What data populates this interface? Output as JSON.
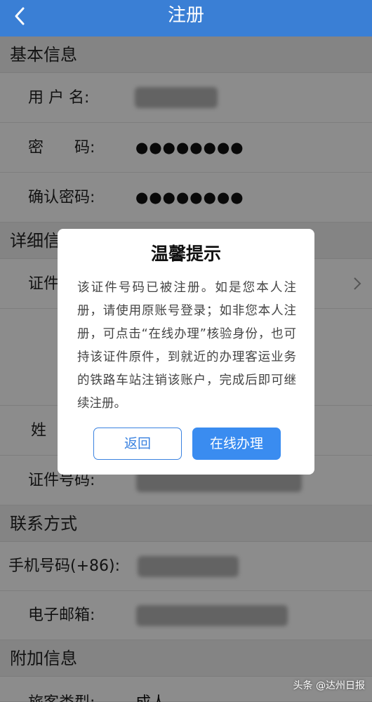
{
  "nav": {
    "title": "注册",
    "back_icon": "chevron-left-icon"
  },
  "sections": {
    "basic": "基本信息",
    "detail": "详细信息",
    "contact": "联系方式",
    "extra": "附加信息"
  },
  "basic_rows": {
    "username_label": "用 户 名:",
    "password_label": "密　　码:",
    "password_value": "●●●●●●●●",
    "confirm_label": "确认密码:",
    "confirm_value": "●●●●●●●●"
  },
  "detail_rows": {
    "idtype_label": "证件",
    "name_label": "姓",
    "idnum_label": "证件号码:"
  },
  "contact_rows": {
    "phone_label": "手机号码(+86):",
    "email_label": "电子邮箱:"
  },
  "extra_rows": {
    "passenger_label": "旅客类型:",
    "passenger_value": "成人"
  },
  "dialog": {
    "title": "温馨提示",
    "message": "该证件号码已被注册。如是您本人注册，请使用原账号登录；如非您本人注册，可点击“在线办理”核验身份，也可持该证件原件，到就近的办理客运业务的铁路车站注销该账户，完成后即可继续注册。",
    "back_label": "返回",
    "online_label": "在线办理"
  },
  "colors": {
    "nav_bg": "#3a7fd5",
    "primary_button": "#3a8cf0",
    "overlay": "rgba(0,0,0,0.45)"
  },
  "watermark": "头条 @达州日报"
}
